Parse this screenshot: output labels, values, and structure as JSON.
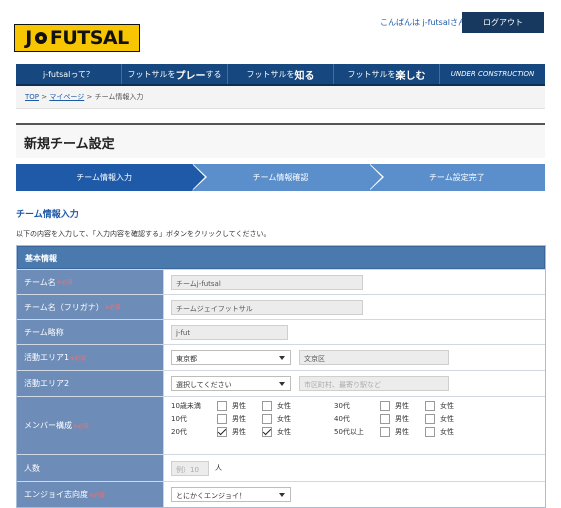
{
  "header": {
    "logo_text": "J-FUTSAL",
    "greeting": "こんばんは j-futsalさん",
    "logout_label": "ログアウト"
  },
  "nav": [
    {
      "pre": "j-futsal",
      "em": "",
      "post": "って？"
    },
    {
      "pre": "フットサルを",
      "em": "プレー",
      "post": "する"
    },
    {
      "pre": "フットサルを",
      "em": "知る",
      "post": ""
    },
    {
      "pre": "フットサルを",
      "em": "楽しむ",
      "post": ""
    },
    {
      "pre": "UNDER CONSTRUCTION",
      "em": "",
      "post": ""
    }
  ],
  "breadcrumb": {
    "items": [
      "TOP",
      "マイページ",
      "チーム情報入力"
    ],
    "separator": ">"
  },
  "page_title": "新規チーム設定",
  "steps": [
    "チーム情報入力",
    "チーム情報確認",
    "チーム設定完了"
  ],
  "section_title": "チーム情報入力",
  "instruction": "以下の内容を入力して、「入力内容を確認する」ボタンをクリックしてください。",
  "form": {
    "header": "基本情報",
    "required_mark": "※必須",
    "team_name": {
      "label": "チーム名",
      "value": "チームj-futsal"
    },
    "team_kana": {
      "label": "チーム名（フリガナ）",
      "value": "チームジェイフットサル"
    },
    "team_short": {
      "label": "チーム略称",
      "value": "j-fut"
    },
    "area1": {
      "label": "活動エリア1",
      "select": "東京都",
      "city": "文京区"
    },
    "area2": {
      "label": "活動エリア2",
      "select": "選択してください",
      "city_placeholder": "市区町村、最寄り駅など"
    },
    "members": {
      "label": "メンバー構成",
      "male": "男性",
      "female": "女性",
      "ages": [
        {
          "age": "10歳未満",
          "male": false,
          "female": false
        },
        {
          "age": "30代",
          "male": false,
          "female": false
        },
        {
          "age": "10代",
          "male": false,
          "female": false
        },
        {
          "age": "40代",
          "male": false,
          "female": false
        },
        {
          "age": "20代",
          "male": true,
          "female": true
        },
        {
          "age": "50代以上",
          "male": false,
          "female": false
        }
      ]
    },
    "count": {
      "label": "人数",
      "placeholder": "例）10",
      "unit": "人"
    },
    "orientation": {
      "label": "エンジョイ志向度",
      "select": "とにかくエンジョイ！"
    }
  },
  "colors": {
    "nav_bg": "#16477e",
    "accent_blue": "#1e5aa8",
    "logo_yellow": "#f7c600",
    "label_bg": "#6d8db8",
    "required_red": "#ff6a6a"
  }
}
